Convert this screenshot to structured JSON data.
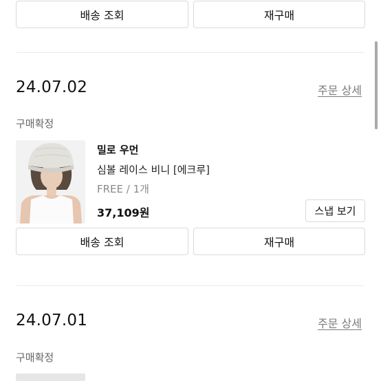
{
  "top_order": {
    "track_label": "배송 조회",
    "rebuy_label": "재구매"
  },
  "orders": [
    {
      "date": "24.07.02",
      "detail_link": "주문 상세",
      "status": "구매확정",
      "item": {
        "brand": "밀로 우먼",
        "name": "심볼 레이스 비니 [에크루]",
        "option": "FREE / 1개",
        "price": "37,109원",
        "snap_label": "스냅 보기",
        "image_icon": "beanie-product-photo"
      },
      "track_label": "배송 조회",
      "rebuy_label": "재구매"
    },
    {
      "date": "24.07.01",
      "detail_link": "주문 상세",
      "status": "구매확정"
    }
  ],
  "colors": {
    "text_primary": "#111111",
    "text_secondary": "#666666",
    "link_gray": "#7a7a7a",
    "border": "#d9d9d9",
    "divider": "#ebebeb"
  }
}
